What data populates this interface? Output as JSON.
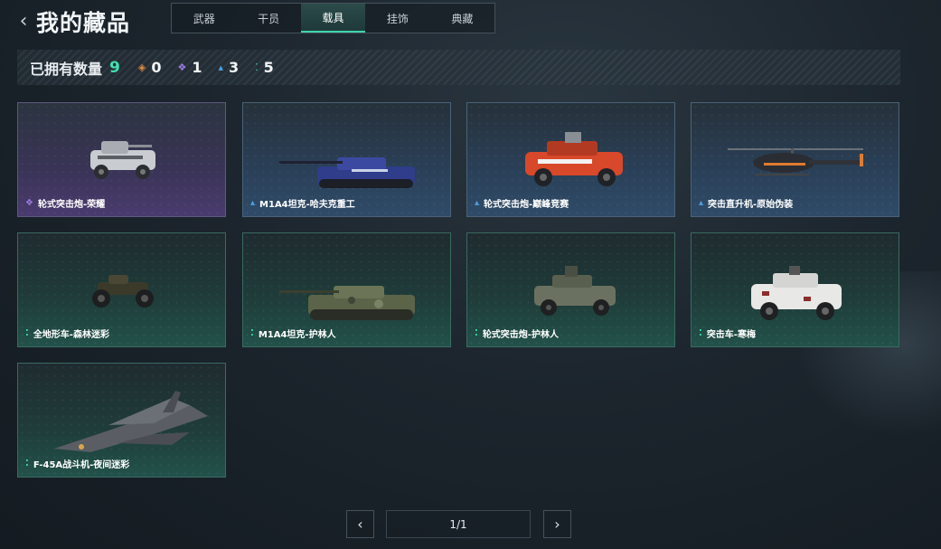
{
  "header": {
    "title": "我的藏品",
    "back_icon": "chevron-left-icon"
  },
  "tabs": [
    {
      "label": "武器",
      "active": false
    },
    {
      "label": "干员",
      "active": false
    },
    {
      "label": "载具",
      "active": true
    },
    {
      "label": "挂饰",
      "active": false
    },
    {
      "label": "典藏",
      "active": false
    }
  ],
  "stats": {
    "label": "已拥有数量",
    "total": "9",
    "rarities": [
      {
        "icon": "orange-diamond-icon",
        "symbol": "◈",
        "color": "#e08a3c",
        "value": "0"
      },
      {
        "icon": "purple-diamond-icon",
        "symbol": "❖",
        "color": "#9b7be0",
        "value": "1"
      },
      {
        "icon": "blue-chevron-icon",
        "symbol": "▴",
        "color": "#4f9fe0",
        "value": "3"
      },
      {
        "icon": "green-dots-icon",
        "symbol": "⁚",
        "color": "#3fe0b0",
        "value": "5"
      }
    ]
  },
  "items": [
    {
      "name": "轮式突击炮-荣耀",
      "rarity": "purple",
      "rarity_icon": "purple-diamond-icon",
      "vehicle": "armored-car"
    },
    {
      "name": "M1A4坦克-哈夫克重工",
      "rarity": "blue",
      "rarity_icon": "blue-chevron-icon",
      "vehicle": "tank"
    },
    {
      "name": "轮式突击炮-巅峰竞赛",
      "rarity": "blue",
      "rarity_icon": "blue-chevron-icon",
      "vehicle": "armored-car"
    },
    {
      "name": "突击直升机-原始伪装",
      "rarity": "blue",
      "rarity_icon": "blue-chevron-icon",
      "vehicle": "helicopter"
    },
    {
      "name": "全地形车-森林迷彩",
      "rarity": "green",
      "rarity_icon": "green-dots-icon",
      "vehicle": "atv"
    },
    {
      "name": "M1A4坦克-护林人",
      "rarity": "green",
      "rarity_icon": "green-dots-icon",
      "vehicle": "tank"
    },
    {
      "name": "轮式突击炮-护林人",
      "rarity": "green",
      "rarity_icon": "green-dots-icon",
      "vehicle": "armored-car"
    },
    {
      "name": "突击车-寒梅",
      "rarity": "green",
      "rarity_icon": "green-dots-icon",
      "vehicle": "assault-car"
    },
    {
      "name": "F-45A战斗机-夜间迷彩",
      "rarity": "green",
      "rarity_icon": "green-dots-icon",
      "vehicle": "jet"
    }
  ],
  "pagination": {
    "page": "1/1",
    "prev_icon": "chevron-left-icon",
    "next_icon": "chevron-right-icon"
  }
}
